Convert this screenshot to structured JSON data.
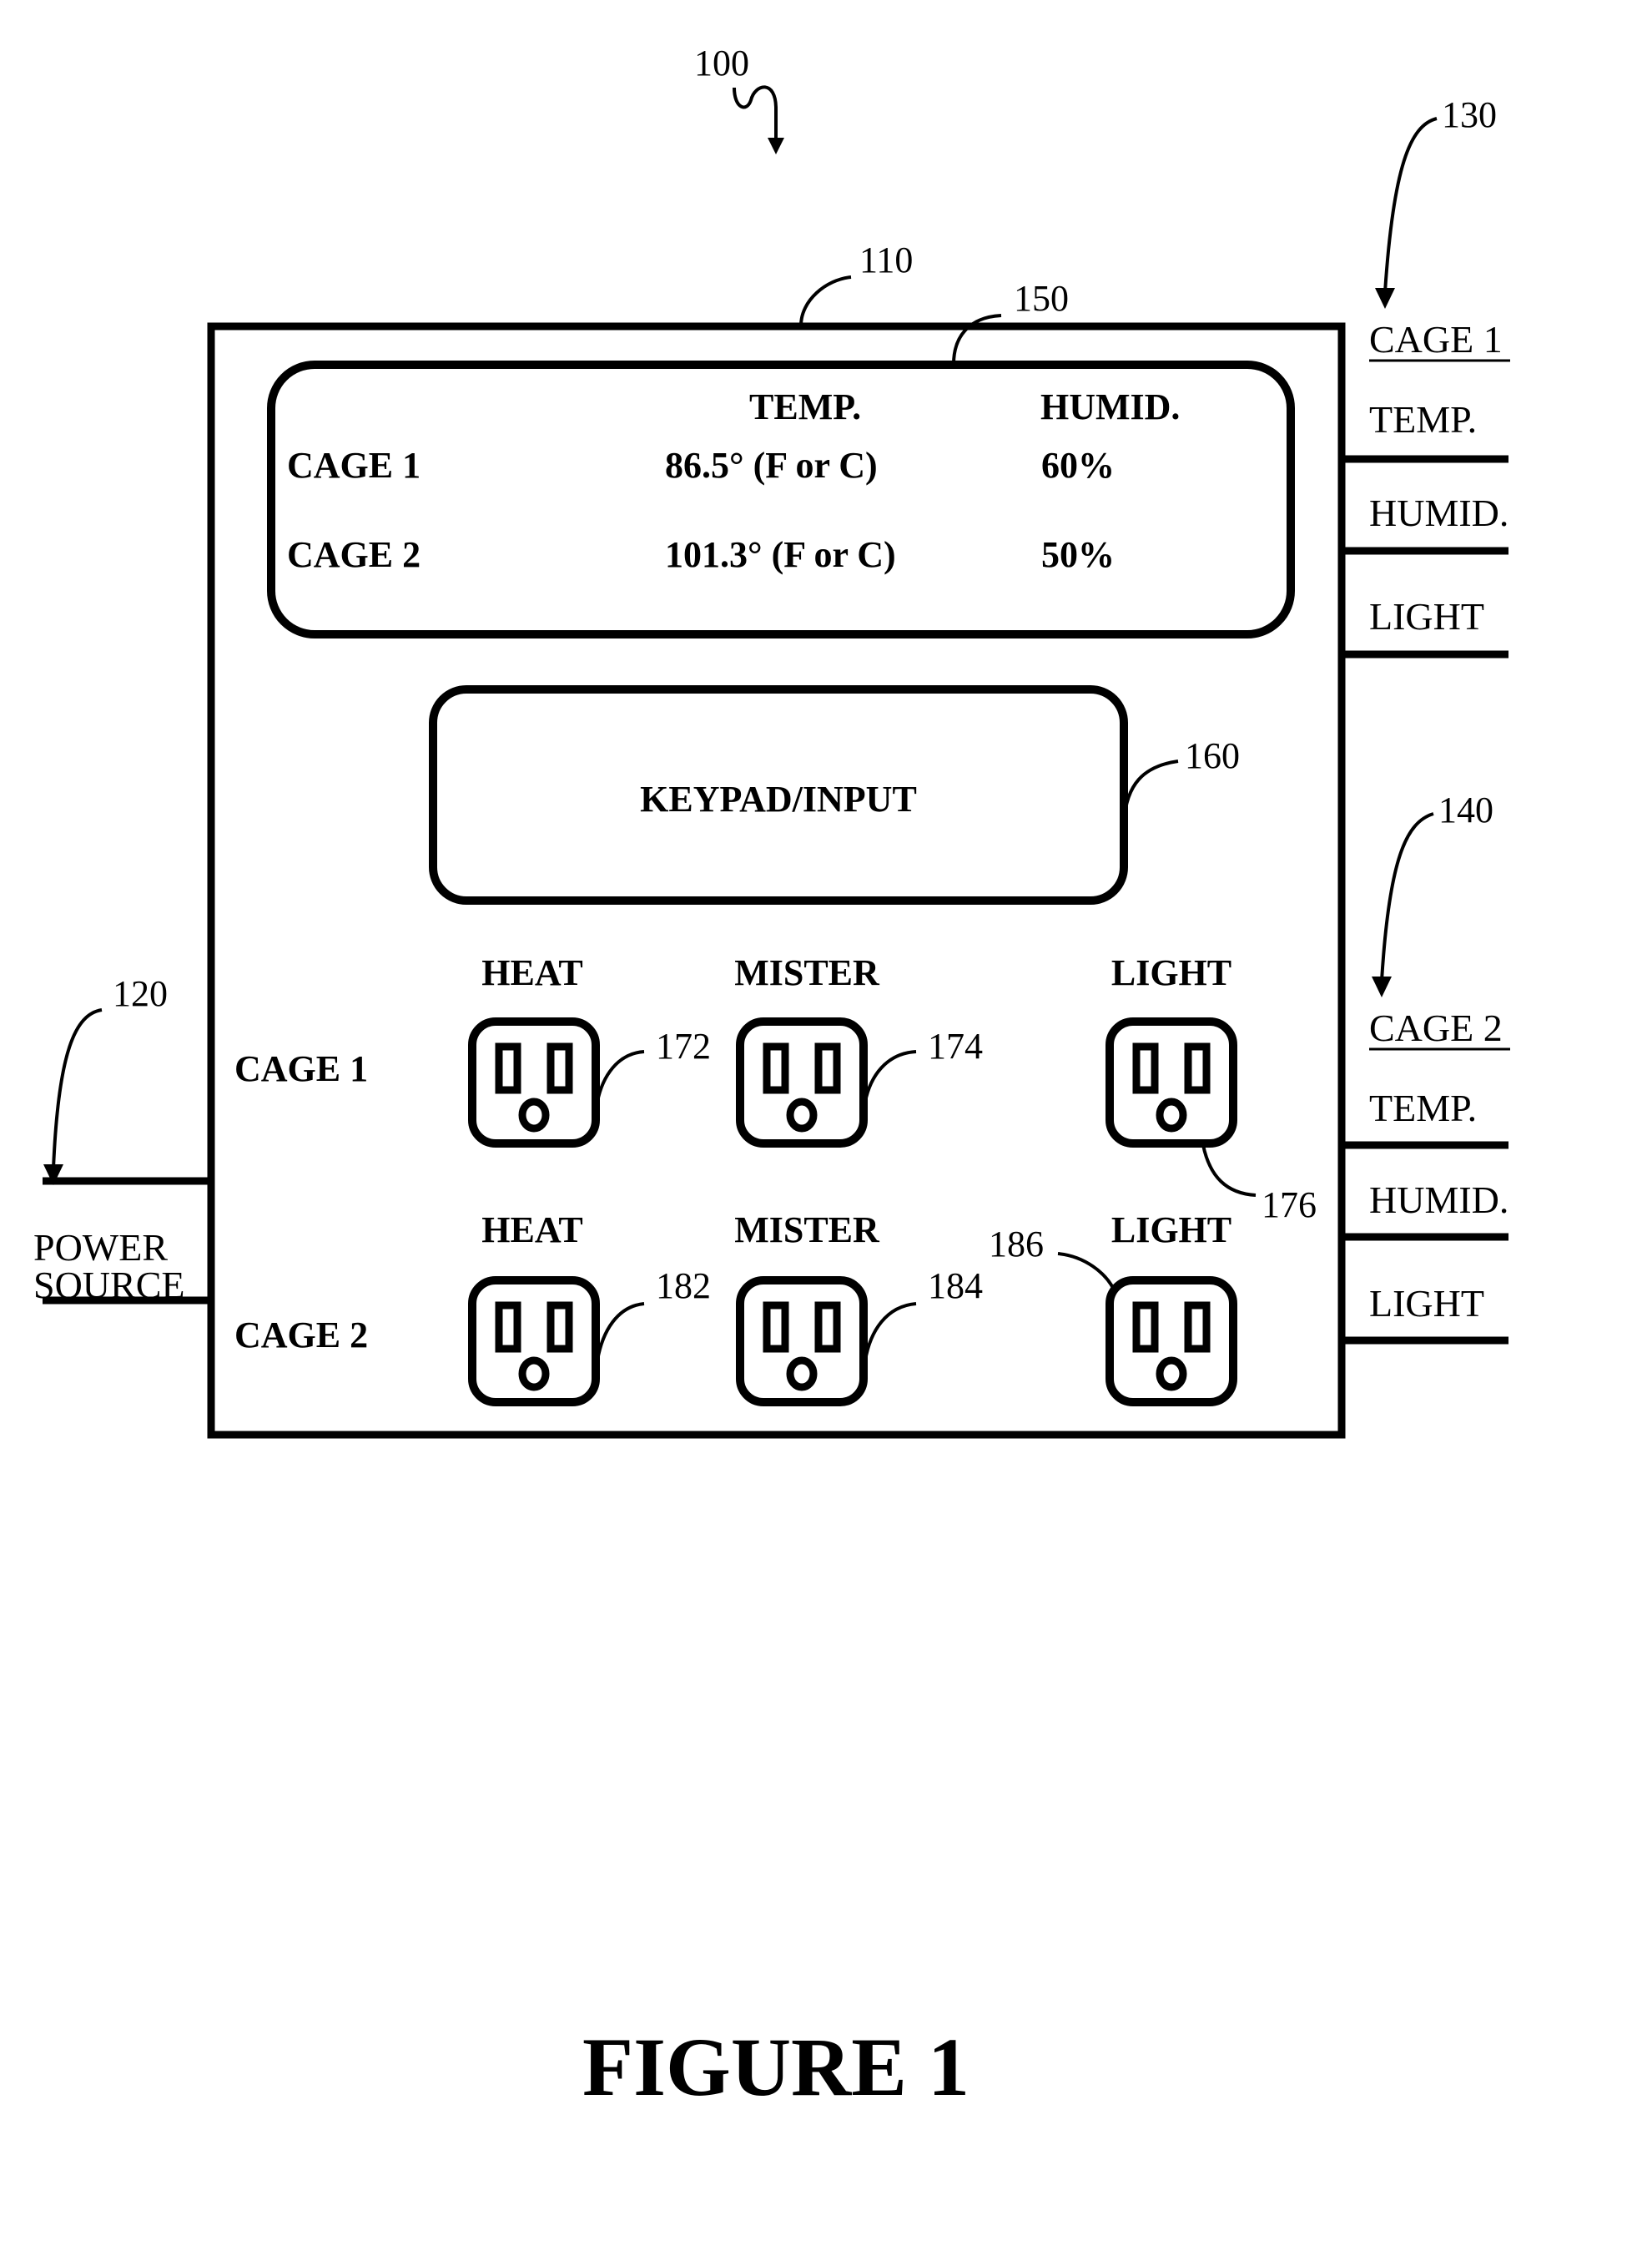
{
  "figure_title": "FIGURE 1",
  "refs": {
    "system": "100",
    "housing": "110",
    "power": "120",
    "cage1_sensors": "130",
    "cage2_sensors": "140",
    "display": "150",
    "keypad": "160",
    "outlet_c1_heat": "172",
    "outlet_c1_mister": "174",
    "outlet_c1_light": "176",
    "outlet_c2_heat": "182",
    "outlet_c2_mister": "184",
    "outlet_c2_light": "186"
  },
  "display": {
    "col_temp": "TEMP.",
    "col_humid": "HUMID.",
    "rows": [
      {
        "label": "CAGE 1",
        "temp": "86.5° (F or C)",
        "humid": "60%"
      },
      {
        "label": "CAGE 2",
        "temp": "101.3° (F or C)",
        "humid": "50%"
      }
    ]
  },
  "keypad": {
    "label": "KEYPAD/INPUT"
  },
  "outlets": {
    "columns": [
      "HEAT",
      "MISTER",
      "LIGHT"
    ],
    "rows": [
      "CAGE 1",
      "CAGE 2"
    ]
  },
  "power": {
    "line1": "POWER",
    "line2": "SOURCE"
  },
  "sensors": [
    {
      "title": "CAGE 1",
      "items": [
        "TEMP.",
        "HUMID.",
        "LIGHT"
      ]
    },
    {
      "title": "CAGE 2",
      "items": [
        "TEMP.",
        "HUMID.",
        "LIGHT"
      ]
    }
  ]
}
